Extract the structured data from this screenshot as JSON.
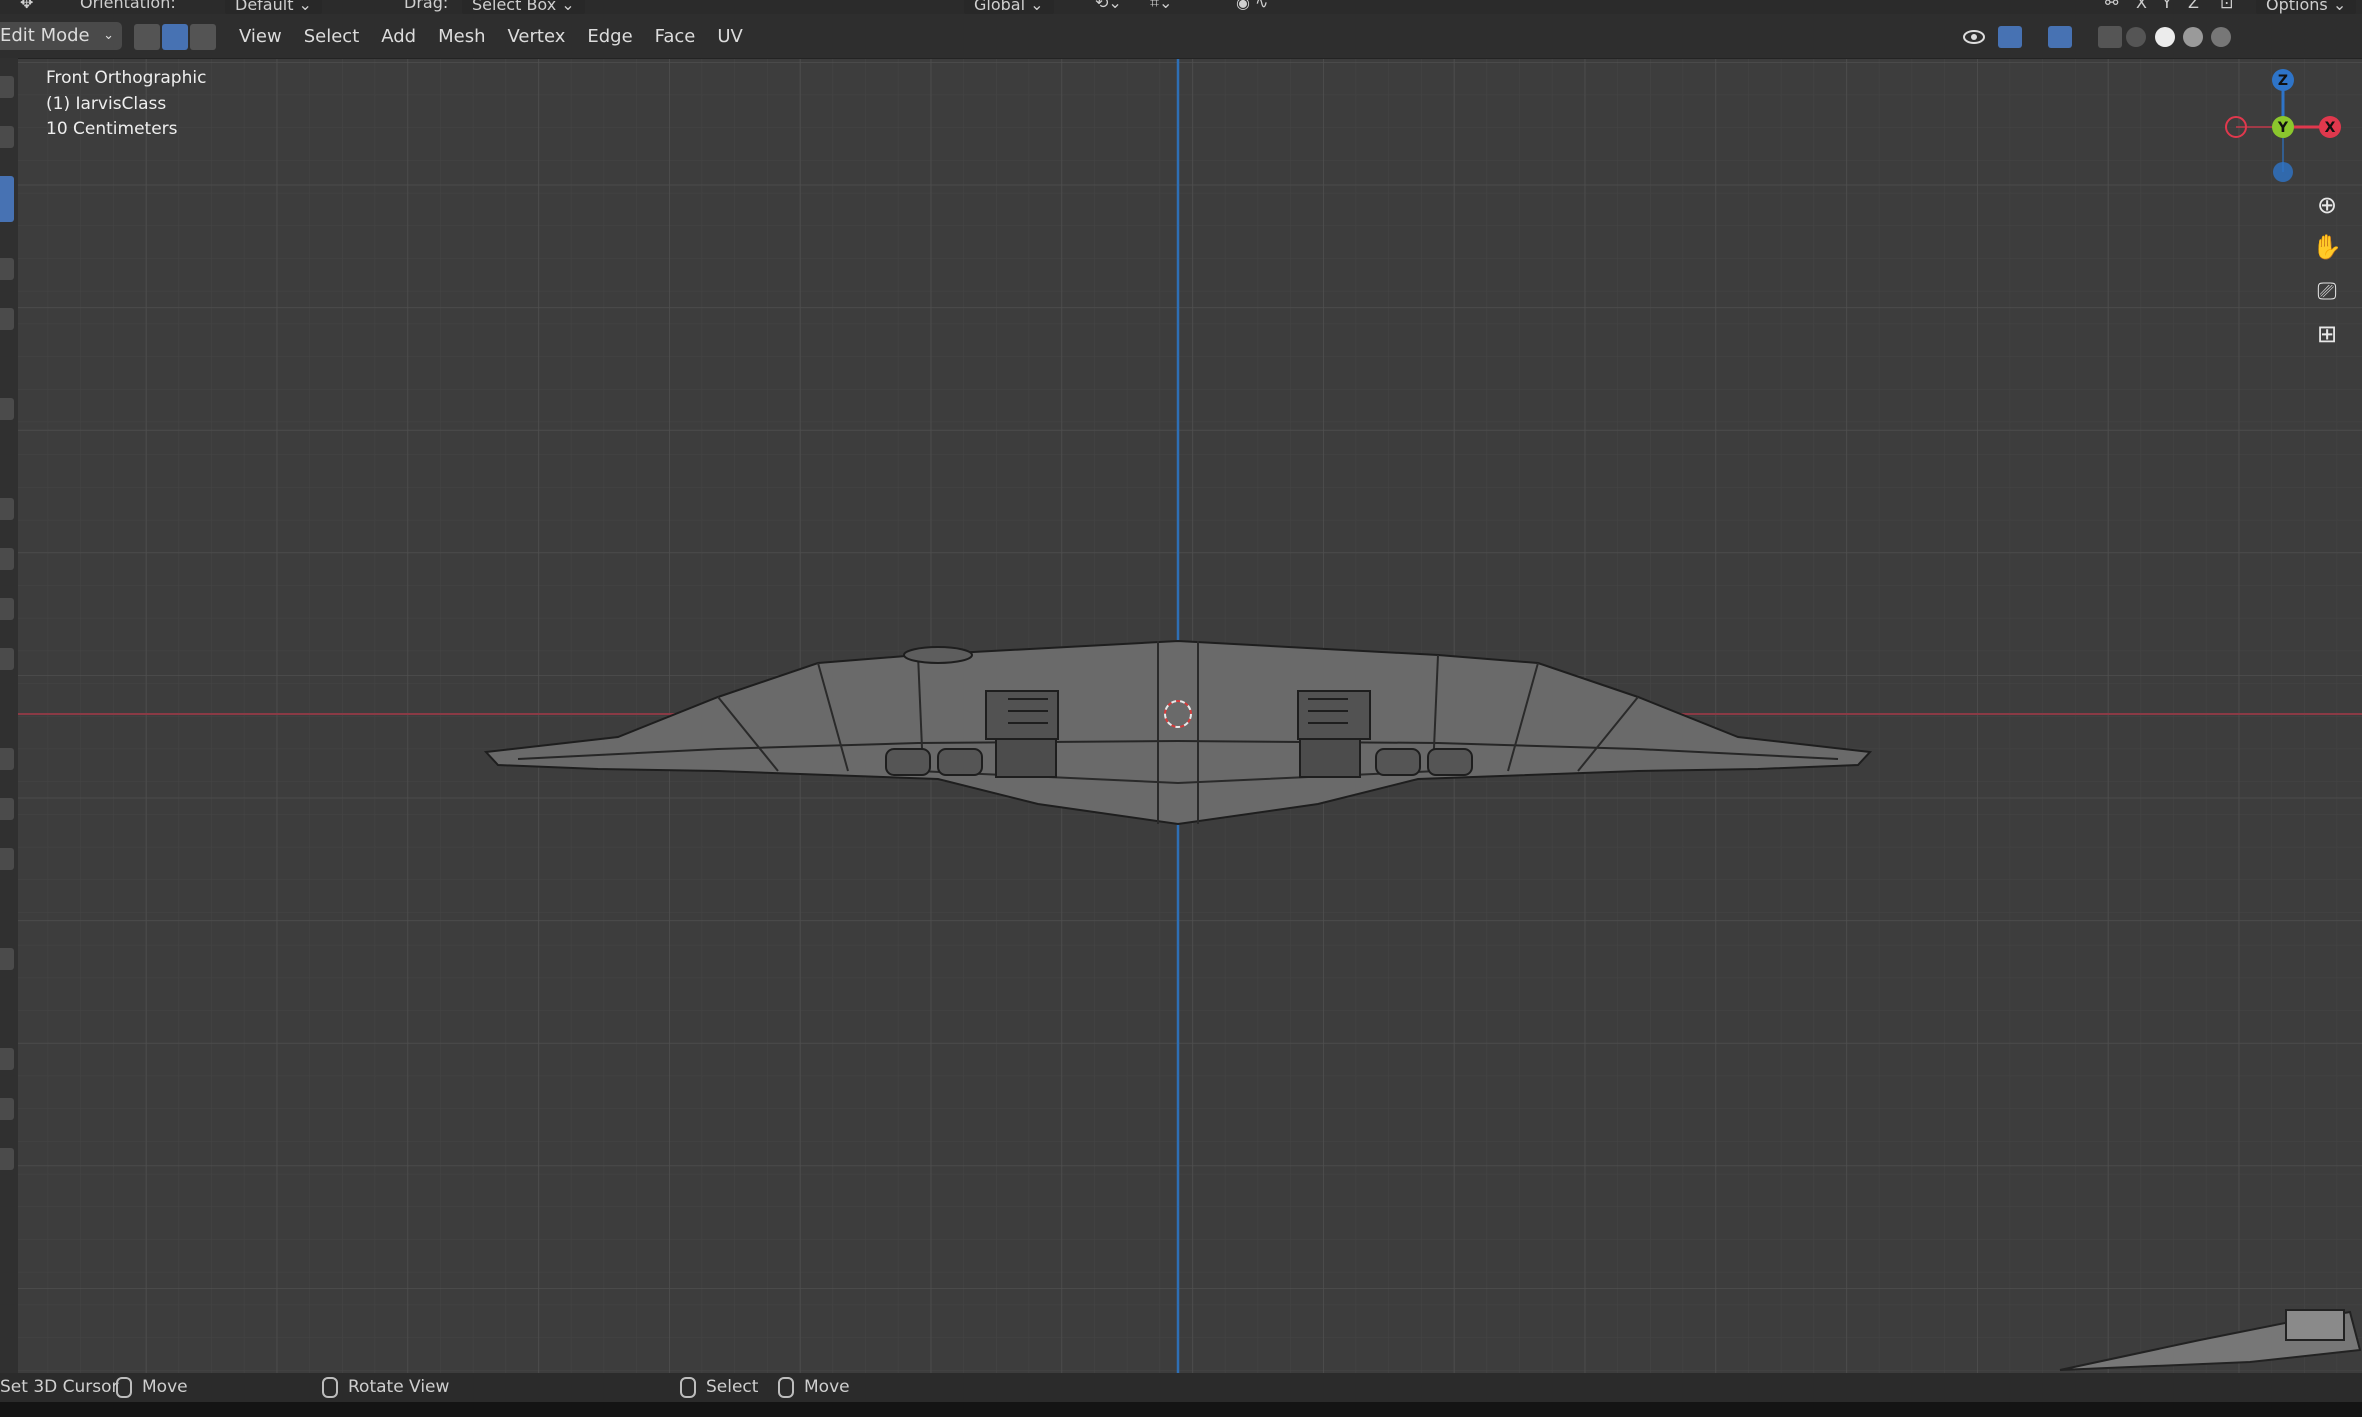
{
  "header_top": {
    "orientation_label": "Orientation:",
    "orientation_value": "Default",
    "drag_label": "Drag:",
    "drag_value": "Select Box",
    "transform_space": "Global",
    "options_label": "Options",
    "axis_x": "X",
    "axis_y": "Y",
    "axis_z": "Z"
  },
  "header": {
    "mode": "Edit Mode",
    "menus": [
      "View",
      "Select",
      "Add",
      "Mesh",
      "Vertex",
      "Edge",
      "Face",
      "UV"
    ]
  },
  "viewport": {
    "view_name": "Front Orthographic",
    "object_name": "(1) IarvisClass",
    "grid_scale": "10 Centimeters",
    "gizmo": {
      "x": "X",
      "y": "Y",
      "z": "Z"
    }
  },
  "status_bar": {
    "left_action": "Set 3D Cursor",
    "left_move": "Move",
    "middle_action": "Rotate View",
    "right_select": "Select",
    "right_move": "Move"
  },
  "colors": {
    "accent": "#4772b3",
    "x_axis": "#e0384d",
    "y_axis": "#8bc72d",
    "z_axis": "#2e74c8",
    "viewport_bg": "#3d3d3d"
  }
}
